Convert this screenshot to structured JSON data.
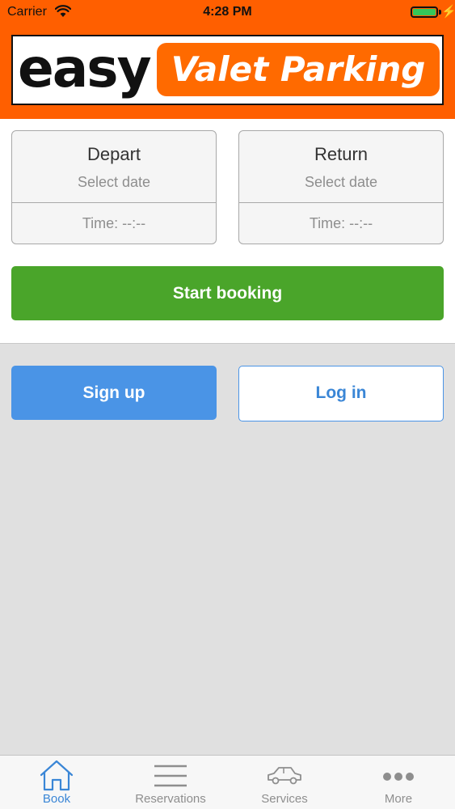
{
  "status_bar": {
    "carrier": "Carrier",
    "time": "4:28 PM",
    "battery_level": 1.0
  },
  "logo": {
    "easy_text": "easy",
    "valet_text": "Valet Parking"
  },
  "booking": {
    "depart": {
      "title": "Depart",
      "date_placeholder": "Select date",
      "time_placeholder": "Time: --:--"
    },
    "return": {
      "title": "Return",
      "date_placeholder": "Select date",
      "time_placeholder": "Time: --:--"
    },
    "start_label": "Start booking"
  },
  "auth": {
    "signup_label": "Sign up",
    "login_label": "Log in"
  },
  "tabbar": {
    "tabs": [
      {
        "label": "Book",
        "icon": "home-icon",
        "active": true
      },
      {
        "label": "Reservations",
        "icon": "list-icon",
        "active": false
      },
      {
        "label": "Services",
        "icon": "car-icon",
        "active": false
      },
      {
        "label": "More",
        "icon": "more-icon",
        "active": false
      }
    ]
  },
  "colors": {
    "brand_orange": "#ff5f00",
    "start_green": "#4aa52a",
    "accent_blue": "#4a94e6",
    "inactive_gray": "#8e8e8e"
  }
}
